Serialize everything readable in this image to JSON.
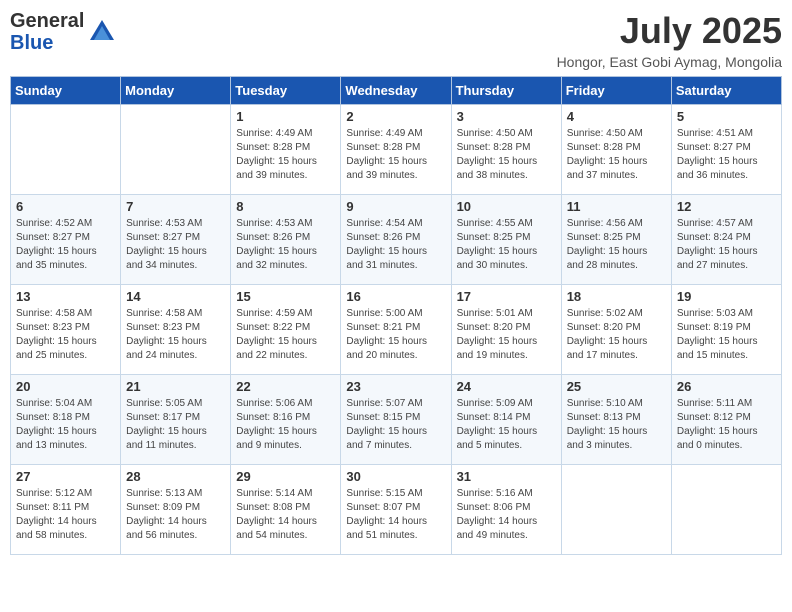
{
  "header": {
    "logo_general": "General",
    "logo_blue": "Blue",
    "month_year": "July 2025",
    "location": "Hongor, East Gobi Aymag, Mongolia"
  },
  "weekdays": [
    "Sunday",
    "Monday",
    "Tuesday",
    "Wednesday",
    "Thursday",
    "Friday",
    "Saturday"
  ],
  "weeks": [
    [
      null,
      null,
      {
        "day": 1,
        "sunrise": "4:49 AM",
        "sunset": "8:28 PM",
        "daylight": "15 hours and 39 minutes."
      },
      {
        "day": 2,
        "sunrise": "4:49 AM",
        "sunset": "8:28 PM",
        "daylight": "15 hours and 39 minutes."
      },
      {
        "day": 3,
        "sunrise": "4:50 AM",
        "sunset": "8:28 PM",
        "daylight": "15 hours and 38 minutes."
      },
      {
        "day": 4,
        "sunrise": "4:50 AM",
        "sunset": "8:28 PM",
        "daylight": "15 hours and 37 minutes."
      },
      {
        "day": 5,
        "sunrise": "4:51 AM",
        "sunset": "8:27 PM",
        "daylight": "15 hours and 36 minutes."
      }
    ],
    [
      {
        "day": 6,
        "sunrise": "4:52 AM",
        "sunset": "8:27 PM",
        "daylight": "15 hours and 35 minutes."
      },
      {
        "day": 7,
        "sunrise": "4:53 AM",
        "sunset": "8:27 PM",
        "daylight": "15 hours and 34 minutes."
      },
      {
        "day": 8,
        "sunrise": "4:53 AM",
        "sunset": "8:26 PM",
        "daylight": "15 hours and 32 minutes."
      },
      {
        "day": 9,
        "sunrise": "4:54 AM",
        "sunset": "8:26 PM",
        "daylight": "15 hours and 31 minutes."
      },
      {
        "day": 10,
        "sunrise": "4:55 AM",
        "sunset": "8:25 PM",
        "daylight": "15 hours and 30 minutes."
      },
      {
        "day": 11,
        "sunrise": "4:56 AM",
        "sunset": "8:25 PM",
        "daylight": "15 hours and 28 minutes."
      },
      {
        "day": 12,
        "sunrise": "4:57 AM",
        "sunset": "8:24 PM",
        "daylight": "15 hours and 27 minutes."
      }
    ],
    [
      {
        "day": 13,
        "sunrise": "4:58 AM",
        "sunset": "8:23 PM",
        "daylight": "15 hours and 25 minutes."
      },
      {
        "day": 14,
        "sunrise": "4:58 AM",
        "sunset": "8:23 PM",
        "daylight": "15 hours and 24 minutes."
      },
      {
        "day": 15,
        "sunrise": "4:59 AM",
        "sunset": "8:22 PM",
        "daylight": "15 hours and 22 minutes."
      },
      {
        "day": 16,
        "sunrise": "5:00 AM",
        "sunset": "8:21 PM",
        "daylight": "15 hours and 20 minutes."
      },
      {
        "day": 17,
        "sunrise": "5:01 AM",
        "sunset": "8:20 PM",
        "daylight": "15 hours and 19 minutes."
      },
      {
        "day": 18,
        "sunrise": "5:02 AM",
        "sunset": "8:20 PM",
        "daylight": "15 hours and 17 minutes."
      },
      {
        "day": 19,
        "sunrise": "5:03 AM",
        "sunset": "8:19 PM",
        "daylight": "15 hours and 15 minutes."
      }
    ],
    [
      {
        "day": 20,
        "sunrise": "5:04 AM",
        "sunset": "8:18 PM",
        "daylight": "15 hours and 13 minutes."
      },
      {
        "day": 21,
        "sunrise": "5:05 AM",
        "sunset": "8:17 PM",
        "daylight": "15 hours and 11 minutes."
      },
      {
        "day": 22,
        "sunrise": "5:06 AM",
        "sunset": "8:16 PM",
        "daylight": "15 hours and 9 minutes."
      },
      {
        "day": 23,
        "sunrise": "5:07 AM",
        "sunset": "8:15 PM",
        "daylight": "15 hours and 7 minutes."
      },
      {
        "day": 24,
        "sunrise": "5:09 AM",
        "sunset": "8:14 PM",
        "daylight": "15 hours and 5 minutes."
      },
      {
        "day": 25,
        "sunrise": "5:10 AM",
        "sunset": "8:13 PM",
        "daylight": "15 hours and 3 minutes."
      },
      {
        "day": 26,
        "sunrise": "5:11 AM",
        "sunset": "8:12 PM",
        "daylight": "15 hours and 0 minutes."
      }
    ],
    [
      {
        "day": 27,
        "sunrise": "5:12 AM",
        "sunset": "8:11 PM",
        "daylight": "14 hours and 58 minutes."
      },
      {
        "day": 28,
        "sunrise": "5:13 AM",
        "sunset": "8:09 PM",
        "daylight": "14 hours and 56 minutes."
      },
      {
        "day": 29,
        "sunrise": "5:14 AM",
        "sunset": "8:08 PM",
        "daylight": "14 hours and 54 minutes."
      },
      {
        "day": 30,
        "sunrise": "5:15 AM",
        "sunset": "8:07 PM",
        "daylight": "14 hours and 51 minutes."
      },
      {
        "day": 31,
        "sunrise": "5:16 AM",
        "sunset": "8:06 PM",
        "daylight": "14 hours and 49 minutes."
      },
      null,
      null
    ]
  ],
  "labels": {
    "sunrise_prefix": "Sunrise: ",
    "sunset_prefix": "Sunset: ",
    "daylight_prefix": "Daylight: "
  }
}
